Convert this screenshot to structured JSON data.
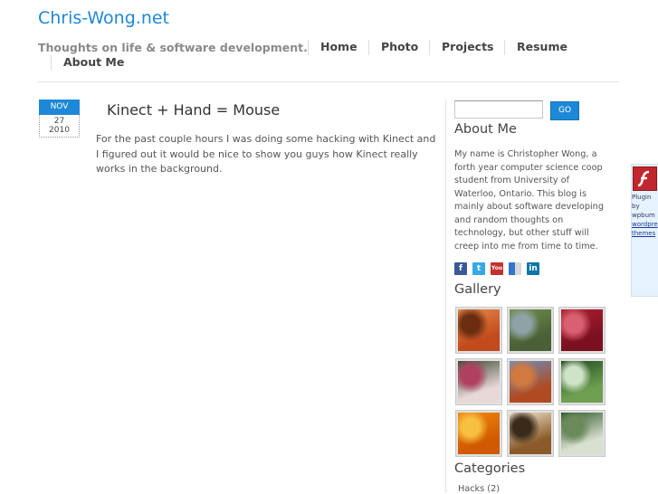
{
  "site": {
    "title": "Chris-Wong.net",
    "tagline": "Thoughts on life & software development."
  },
  "nav": {
    "items": [
      {
        "label": "Home"
      },
      {
        "label": "Photo"
      },
      {
        "label": "Projects"
      },
      {
        "label": "Resume"
      },
      {
        "label": "About Me"
      }
    ]
  },
  "post": {
    "date": {
      "month": "NOV",
      "day": "27",
      "year": "2010"
    },
    "title": "Kinect + Hand = Mouse",
    "body": "For the past couple hours I was doing some hacking with Kinect and I figured out it would be nice to show you guys how Kinect really works in the background."
  },
  "sidebar": {
    "search": {
      "button": "GO",
      "value": "",
      "placeholder": ""
    },
    "about": {
      "title": "About Me",
      "text": "My name is Christopher Wong, a forth year computer science coop student from University of Waterloo, Ontario. This blog is mainly about software developing and random thoughts on technology, but other stuff will creep into me from time to time."
    },
    "social": [
      {
        "icon": "facebook-icon",
        "color": "#3b5998"
      },
      {
        "icon": "twitter-icon",
        "color": "#35a9e6"
      },
      {
        "icon": "youtube-icon",
        "color": "#c4302b"
      },
      {
        "icon": "delicious-icon",
        "color": "#3274d1"
      },
      {
        "icon": "linkedin-icon",
        "color": "#0e76a8"
      }
    ],
    "gallery": {
      "title": "Gallery",
      "photos": [
        {
          "name": "desert-dunes",
          "colors": [
            "#e58a4a",
            "#c24a1c",
            "#6b2d10"
          ]
        },
        {
          "name": "canyon-river",
          "colors": [
            "#6f8f4a",
            "#4a6036",
            "#8fa2a6"
          ]
        },
        {
          "name": "red-flower",
          "colors": [
            "#b02030",
            "#7a1020",
            "#d86070"
          ]
        },
        {
          "name": "pink-blossoms",
          "colors": [
            "#3a4a30",
            "#e8d8d8",
            "#b04060"
          ]
        },
        {
          "name": "monument-valley",
          "colors": [
            "#6a8fc0",
            "#b04a20",
            "#d07a40"
          ]
        },
        {
          "name": "forest-waterfall",
          "colors": [
            "#1f4a20",
            "#6fa050",
            "#cfe3c8"
          ]
        },
        {
          "name": "orange-flowers",
          "colors": [
            "#f08a10",
            "#d05a00",
            "#f8c040"
          ]
        },
        {
          "name": "autumn-tree",
          "colors": [
            "#f4e8d0",
            "#8a5a2a",
            "#3a2a1a"
          ]
        },
        {
          "name": "stream-rocks",
          "colors": [
            "#2f5a2a",
            "#d8e0d0",
            "#6a8a5a"
          ]
        }
      ]
    },
    "categories": {
      "title": "Categories",
      "items": [
        {
          "label": "Hacks (2)"
        }
      ]
    }
  },
  "flash_badge": {
    "icon": "flash-icon",
    "lines": [
      "Plugin",
      "by",
      "wpbum",
      "wordpre",
      "themes"
    ]
  }
}
